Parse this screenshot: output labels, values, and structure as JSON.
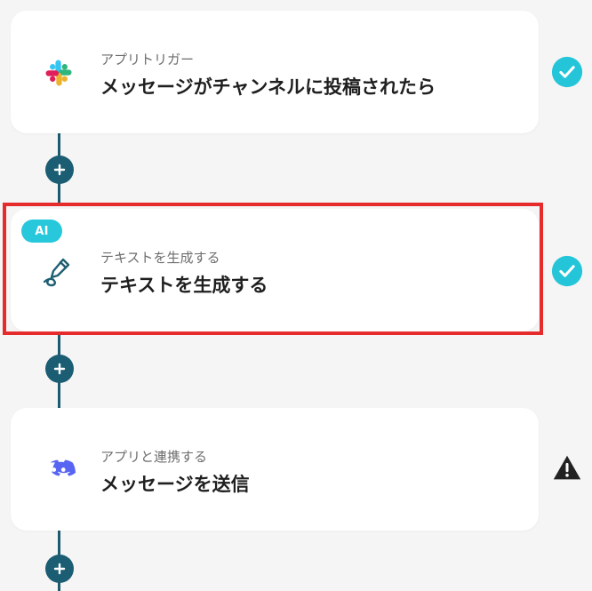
{
  "steps": [
    {
      "caption": "アプリトリガー",
      "title": "メッセージがチャンネルに投稿されたら",
      "status": "success"
    },
    {
      "badge": "AI",
      "caption": "テキストを生成する",
      "title": "テキストを生成する",
      "status": "success"
    },
    {
      "caption": "アプリと連携する",
      "title": "メッセージを送信",
      "status": "warning"
    }
  ],
  "colors": {
    "background": "#f5f5f5",
    "card": "#ffffff",
    "connector": "#1c5a6d",
    "plus_button": "#1b5d73",
    "success": "#25c5d9",
    "warning": "#222222",
    "highlight": "#e52b2b",
    "ai_badge": "#27c7dc",
    "discord": "#5865F2"
  },
  "icons": {
    "step_1": "slack-icon",
    "step_2": "pencil-text-icon",
    "step_3": "discord-icon",
    "add": "plus-icon",
    "success": "check-circle-icon",
    "warning": "warning-triangle-icon"
  }
}
